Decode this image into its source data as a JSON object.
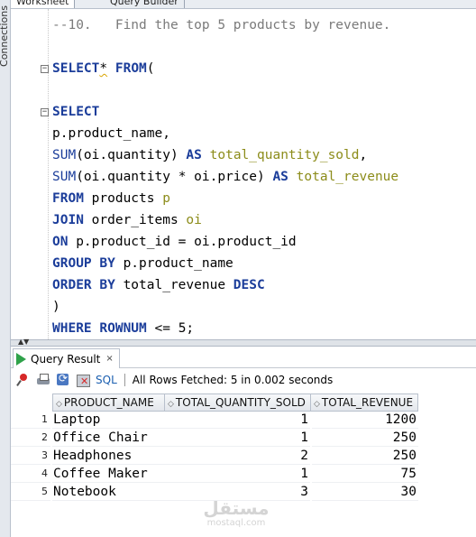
{
  "sidebar": {
    "connections_label": "Connections"
  },
  "tabs": [
    {
      "label": "Worksheet"
    },
    {
      "label": "Query Builder"
    }
  ],
  "editor": {
    "lines": [
      {
        "tokens": [
          {
            "t": "--10.   Find the top 5 products by revenue.",
            "c": "cm"
          }
        ]
      },
      {
        "tokens": []
      },
      {
        "tokens": [
          {
            "t": "SELECT",
            "c": "kw"
          },
          {
            "t": "*",
            "c": "squig"
          },
          {
            "t": " ",
            "c": ""
          },
          {
            "t": "FROM",
            "c": "kw"
          },
          {
            "t": "(",
            "c": ""
          }
        ]
      },
      {
        "tokens": []
      },
      {
        "tokens": [
          {
            "t": "SELECT",
            "c": "kw"
          }
        ]
      },
      {
        "tokens": [
          {
            "t": "p.product_name,",
            "c": ""
          }
        ]
      },
      {
        "tokens": [
          {
            "t": "SUM",
            "c": "fn"
          },
          {
            "t": "(oi.quantity) ",
            "c": ""
          },
          {
            "t": "AS",
            "c": "kw"
          },
          {
            "t": " ",
            "c": ""
          },
          {
            "t": "total_quantity_sold",
            "c": "al"
          },
          {
            "t": ",",
            "c": ""
          }
        ]
      },
      {
        "tokens": [
          {
            "t": "SUM",
            "c": "fn"
          },
          {
            "t": "(oi.quantity * oi.price) ",
            "c": ""
          },
          {
            "t": "AS",
            "c": "kw"
          },
          {
            "t": " ",
            "c": ""
          },
          {
            "t": "total_revenue",
            "c": "al"
          }
        ]
      },
      {
        "tokens": [
          {
            "t": "FROM",
            "c": "kw"
          },
          {
            "t": " products ",
            "c": ""
          },
          {
            "t": "p",
            "c": "al"
          }
        ]
      },
      {
        "tokens": [
          {
            "t": "JOIN",
            "c": "kw"
          },
          {
            "t": " order_items ",
            "c": ""
          },
          {
            "t": "oi",
            "c": "al"
          }
        ]
      },
      {
        "tokens": [
          {
            "t": "ON",
            "c": "kw"
          },
          {
            "t": " p.product_id = oi.product_id",
            "c": ""
          }
        ]
      },
      {
        "tokens": [
          {
            "t": "GROUP BY",
            "c": "kw"
          },
          {
            "t": " p.product_name",
            "c": ""
          }
        ]
      },
      {
        "tokens": [
          {
            "t": "ORDER BY",
            "c": "kw"
          },
          {
            "t": " total_revenue ",
            "c": ""
          },
          {
            "t": "DESC",
            "c": "kw"
          }
        ]
      },
      {
        "tokens": [
          {
            "t": ")",
            "c": ""
          }
        ]
      },
      {
        "tokens": [
          {
            "t": "WHERE",
            "c": "kw"
          },
          {
            "t": " ",
            "c": ""
          },
          {
            "t": "ROWNUM",
            "c": "kw"
          },
          {
            "t": " <= 5;",
            "c": ""
          }
        ]
      }
    ]
  },
  "result": {
    "tab_label": "Query Result",
    "close_label": "×",
    "sql_label": "SQL",
    "status_text": "All Rows Fetched: 5 in 0.002 seconds",
    "columns": [
      "PRODUCT_NAME",
      "TOTAL_QUANTITY_SOLD",
      "TOTAL_REVENUE"
    ],
    "rows": [
      {
        "num": "1",
        "product_name": "Laptop",
        "total_quantity_sold": "1",
        "total_revenue": "1200"
      },
      {
        "num": "2",
        "product_name": "Office Chair",
        "total_quantity_sold": "1",
        "total_revenue": "250"
      },
      {
        "num": "3",
        "product_name": "Headphones",
        "total_quantity_sold": "2",
        "total_revenue": "250"
      },
      {
        "num": "4",
        "product_name": "Coffee Maker",
        "total_quantity_sold": "1",
        "total_revenue": "75"
      },
      {
        "num": "5",
        "product_name": "Notebook",
        "total_quantity_sold": "3",
        "total_revenue": "30"
      }
    ]
  },
  "watermark": {
    "arabic": "مستقل",
    "latin": "mostaql.com"
  }
}
